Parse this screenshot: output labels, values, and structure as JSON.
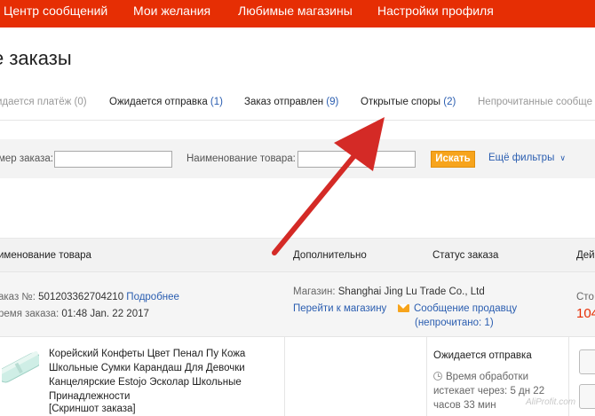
{
  "topnav": {
    "items": [
      {
        "label": "Центр сообщений"
      },
      {
        "label": "Мои желания"
      },
      {
        "label": "Любимые магазины"
      },
      {
        "label": "Настройки профиля"
      }
    ]
  },
  "page": {
    "title": "е заказы"
  },
  "tabs": [
    {
      "label": "идается платёж",
      "count": "(0)"
    },
    {
      "label": "Ожидается отправка",
      "count": "(1)"
    },
    {
      "label": "Заказ отправлен",
      "count": "(9)"
    },
    {
      "label": "Открытые споры",
      "count": "(2)"
    },
    {
      "label": "Непрочитанные сообще",
      "count": ""
    }
  ],
  "filters": {
    "order_label": "мер заказа:",
    "order_value": "",
    "product_label": "Наименование товара:",
    "product_value": "",
    "search_button": "Искать",
    "more_filters": "Ещё фильтры",
    "more_icon": "chevron-down-icon"
  },
  "columns": {
    "product": "именование товара",
    "additional": "Дополнительно",
    "status": "Статус заказа",
    "actions": "Дей"
  },
  "order": {
    "number_label": "аказ №:",
    "number": "501203362704210",
    "details_link": "Подробнее",
    "time_label": "ремя заказа:",
    "time": "01:48 Jan. 22 2017",
    "store_label": "Магазин:",
    "store_name": "Shanghai Jing Lu Trade Co., Ltd",
    "store_link": "Перейти к магазину",
    "message_link": "Сообщение продавцу",
    "message_note": "(непрочитано: 1)",
    "cost_label": "Сто",
    "cost_value": "104"
  },
  "product": {
    "title": "Корейский Конфеты Цвет Пенал Пу Кожа Школьные Сумки Карандаш Для Девочки Канцелярские Estojo Эсколар Школьные Принадлежности",
    "snapshot": "[Скриншот заказа]",
    "status": "Ожидается отправка",
    "processing_text": "Время обработки истекает через: 5 дн 22 часов 33 мин"
  },
  "watermark": "AliProfit.com",
  "colors": {
    "brand_red": "#e62e04",
    "accent_orange": "#f7a41c",
    "link_blue": "#2a5db0",
    "arrow_red": "#d42a26"
  }
}
